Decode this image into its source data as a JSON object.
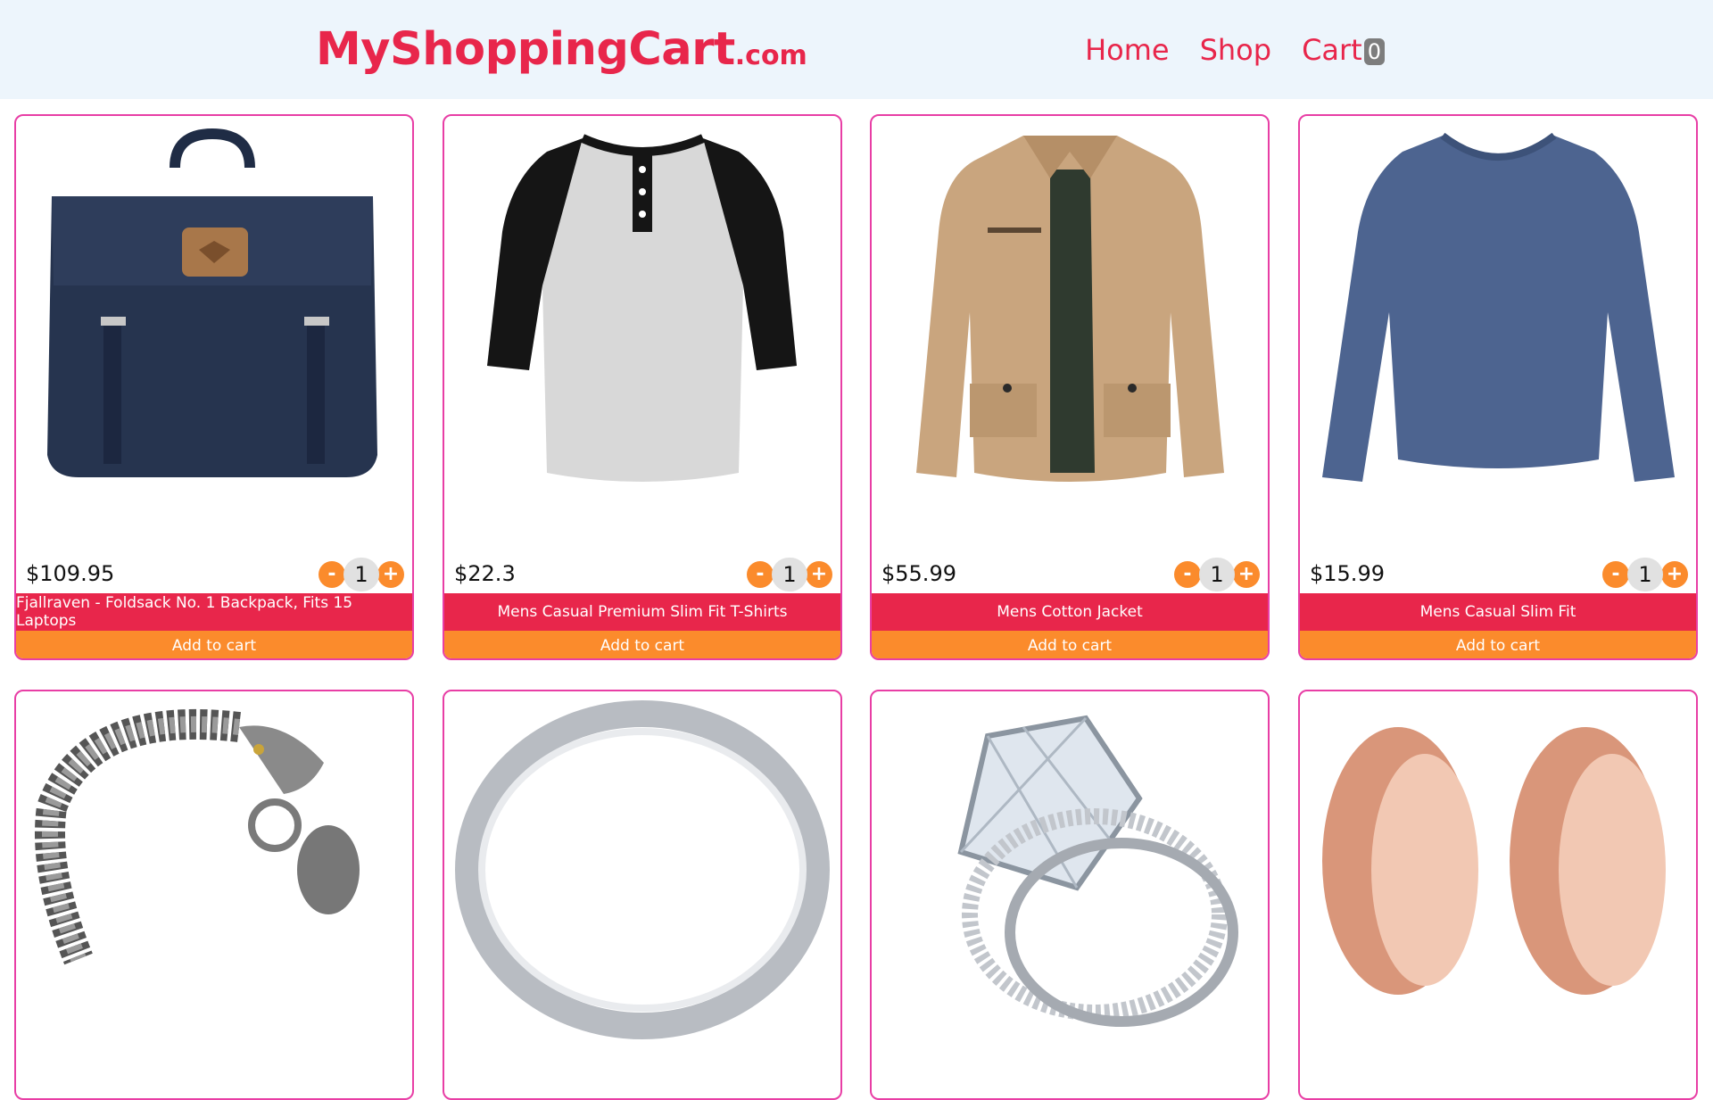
{
  "header": {
    "logo_main": "MyShoppingCart",
    "logo_tld": ".com",
    "nav": {
      "home": "Home",
      "shop": "Shop",
      "cart": "Cart",
      "cart_count": "0"
    }
  },
  "products": [
    {
      "price": "$109.95",
      "title": "Fjallraven - Foldsack No. 1 Backpack, Fits 15 Laptops",
      "qty_minus": "-",
      "qty": "1",
      "qty_plus": "+",
      "add_label": "Add to cart",
      "image": "backpack"
    },
    {
      "price": "$22.3",
      "title": "Mens Casual Premium Slim Fit T-Shirts",
      "qty_minus": "-",
      "qty": "1",
      "qty_plus": "+",
      "add_label": "Add to cart",
      "image": "raglan-tshirt"
    },
    {
      "price": "$55.99",
      "title": "Mens Cotton Jacket",
      "qty_minus": "-",
      "qty": "1",
      "qty_plus": "+",
      "add_label": "Add to cart",
      "image": "cotton-jacket"
    },
    {
      "price": "$15.99",
      "title": "Mens Casual Slim Fit",
      "qty_minus": "-",
      "qty": "1",
      "qty_plus": "+",
      "add_label": "Add to cart",
      "image": "long-sleeve-shirt"
    }
  ],
  "products_row2": [
    {
      "image": "dragon-bracelet"
    },
    {
      "image": "silver-ring"
    },
    {
      "image": "diamond-ring-set"
    },
    {
      "image": "rose-gold-plugs"
    }
  ],
  "colors": {
    "accent_red": "#e8264b",
    "accent_orange": "#fb8b2c",
    "card_border": "#e83ea5",
    "header_bg": "#edf5fc"
  }
}
